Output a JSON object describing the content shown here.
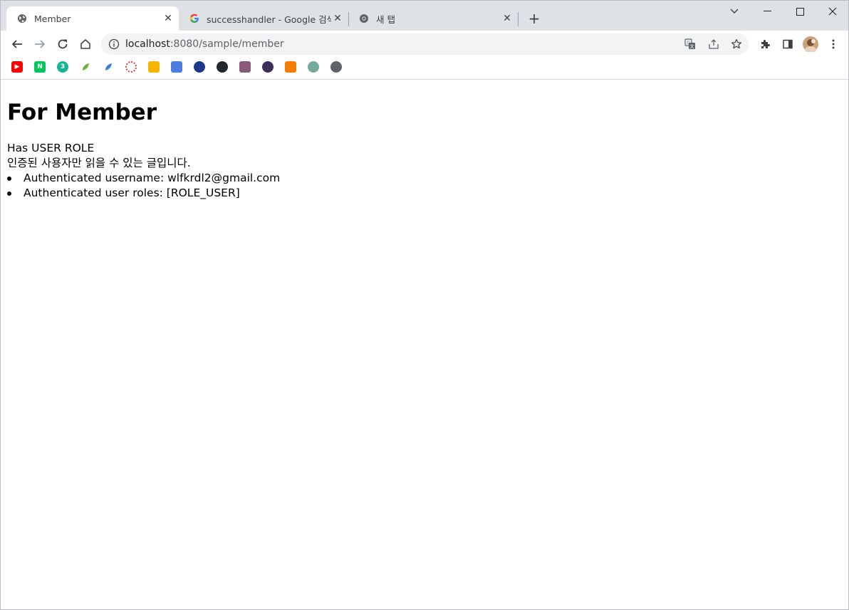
{
  "tabs": [
    {
      "title": "Member",
      "icon": "globe-icon",
      "active": true
    },
    {
      "title": "successhandler - Google 검색",
      "icon": "google-g-icon",
      "active": false
    },
    {
      "title": "새 탭",
      "icon": "chrome-icon",
      "active": false
    }
  ],
  "address_bar": {
    "host": "localhost",
    "rest": ":8080/sample/member"
  },
  "bookmarks": [
    {
      "icon": "youtube-icon",
      "color": "#ff0000",
      "glyph": "▶"
    },
    {
      "icon": "naver-icon",
      "color": "#03c75a",
      "glyph": "N"
    },
    {
      "icon": "green-circle-icon",
      "color": "#19b394",
      "glyph": "3"
    },
    {
      "icon": "leaf-icon",
      "color": "#6db33f",
      "glyph": ""
    },
    {
      "icon": "blue-feather-icon",
      "color": "#3d7de0",
      "glyph": ""
    },
    {
      "icon": "red-ring-icon",
      "color": "#e53935",
      "glyph": ""
    },
    {
      "icon": "yellow-id-icon",
      "color": "#f4b400",
      "glyph": ""
    },
    {
      "icon": "blue-tile-icon",
      "color": "#4f7ddf",
      "glyph": ""
    },
    {
      "icon": "owl-icon",
      "color": "#1d3a8a",
      "glyph": ""
    },
    {
      "icon": "github-icon",
      "color": "#24292e",
      "glyph": ""
    },
    {
      "icon": "photo-icon",
      "color": "#8a5a7a",
      "glyph": ""
    },
    {
      "icon": "avatar-circle-icon",
      "color": "#3b2f5a",
      "glyph": ""
    },
    {
      "icon": "orange-cube-icon",
      "color": "#f57c00",
      "glyph": ""
    },
    {
      "icon": "openai-icon",
      "color": "#74aa9c",
      "glyph": ""
    },
    {
      "icon": "globe-icon",
      "color": "#5f6368",
      "glyph": ""
    }
  ],
  "page": {
    "heading": "For Member",
    "role_line": "Has USER ROLE",
    "notice": "인증된 사용자만 읽을 수 있는 글입니다.",
    "details": [
      "Authenticated username: wlfkrdl2@gmail.com",
      "Authenticated user roles: [ROLE_USER]"
    ]
  }
}
